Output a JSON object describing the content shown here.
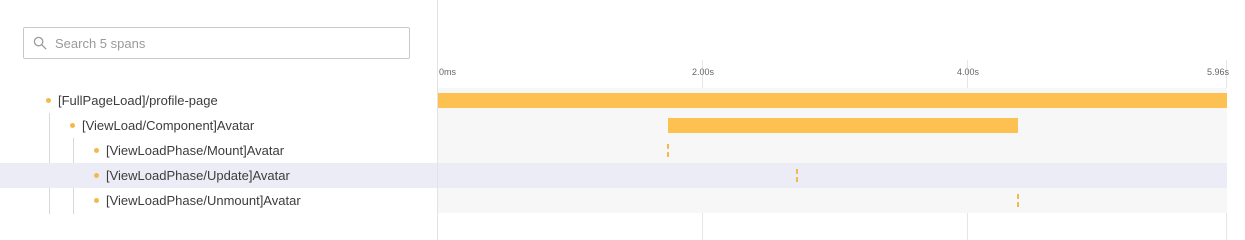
{
  "search": {
    "placeholder": "Search 5 spans",
    "value": ""
  },
  "total_duration_s": 5.96,
  "ticks": [
    {
      "label": "0ms",
      "t": 0
    },
    {
      "label": "2.00s",
      "t": 2.0
    },
    {
      "label": "4.00s",
      "t": 4.0
    },
    {
      "label": "5.96s",
      "t": 5.96
    }
  ],
  "spans": [
    {
      "label": "[FullPageLoad]/profile-page",
      "depth": 0,
      "start_s": 0,
      "end_s": 5.96
    },
    {
      "label": "[ViewLoad/Component]Avatar",
      "depth": 1,
      "start_s": 1.74,
      "end_s": 4.38
    },
    {
      "label": "[ViewLoadPhase/Mount]Avatar",
      "depth": 2,
      "start_s": 1.74,
      "end_s": 1.74
    },
    {
      "label": "[ViewLoadPhase/Update]Avatar",
      "depth": 2,
      "start_s": 2.71,
      "end_s": 2.71,
      "selected": true
    },
    {
      "label": "[ViewLoadPhase/Unmount]Avatar",
      "depth": 2,
      "start_s": 4.38,
      "end_s": 4.38
    }
  ],
  "colors": {
    "bar": "#fdc152",
    "dot": "#f5b84a",
    "selected_row": "#ececf7"
  }
}
